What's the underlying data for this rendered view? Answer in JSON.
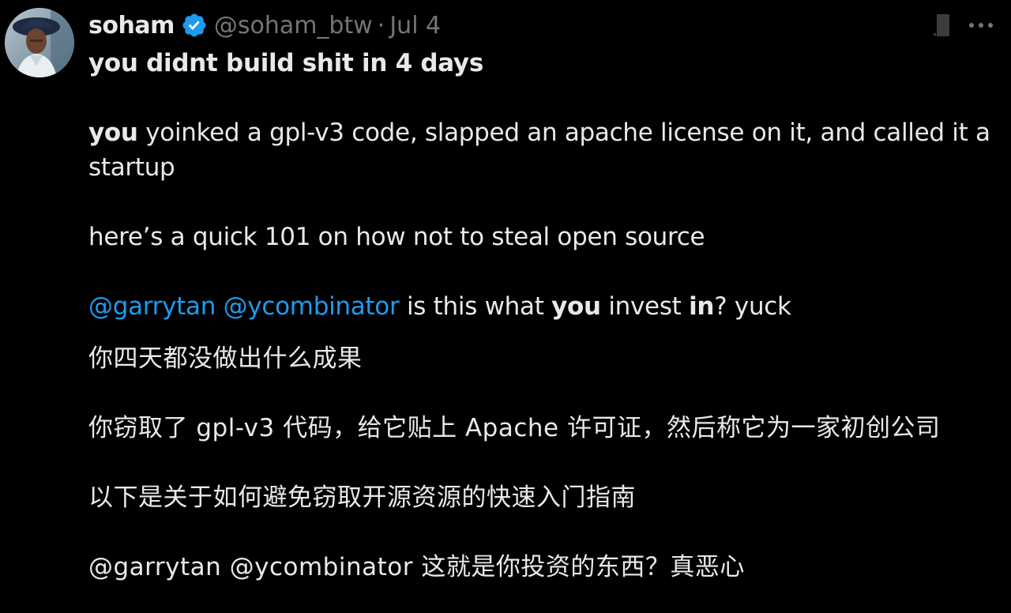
{
  "author": {
    "name": "soham",
    "handle": "@soham_btw",
    "separator": "·",
    "date": "Jul 4",
    "verified": true
  },
  "icons": {
    "verified": "verified-badge-icon",
    "grok": "grok-icon",
    "more": "more-options-icon"
  },
  "colors": {
    "background": "#000000",
    "text": "#e7e9ea",
    "secondary_text": "#71767b",
    "mention": "#1d9bf0",
    "verified": "#1d9bf0"
  },
  "tweet": {
    "line1": "you didnt build shit in 4 days",
    "line2_bold": "you",
    "line2_rest": " yoinked a gpl-v3 code, slapped an apache license on it, and called it a startup",
    "line3": "here’s a quick 101 on how not to steal open source",
    "mention1": "@garrytan",
    "mention2": "@ycombinator",
    "line4_a": " is this what ",
    "line4_bold1": "you",
    "line4_b": " invest ",
    "line4_bold2": "in",
    "line4_c": "? yuck",
    "zh1": "你四天都没做出什么成果",
    "zh2": "你窃取了 gpl-v3 代码，给它贴上 Apache 许可证，然后称它为一家初创公司",
    "zh3": "以下是关于如何避免窃取开源资源的快速入门指南",
    "zh4": "@garrytan @ycombinator 这就是你投资的东西？真恶心"
  }
}
